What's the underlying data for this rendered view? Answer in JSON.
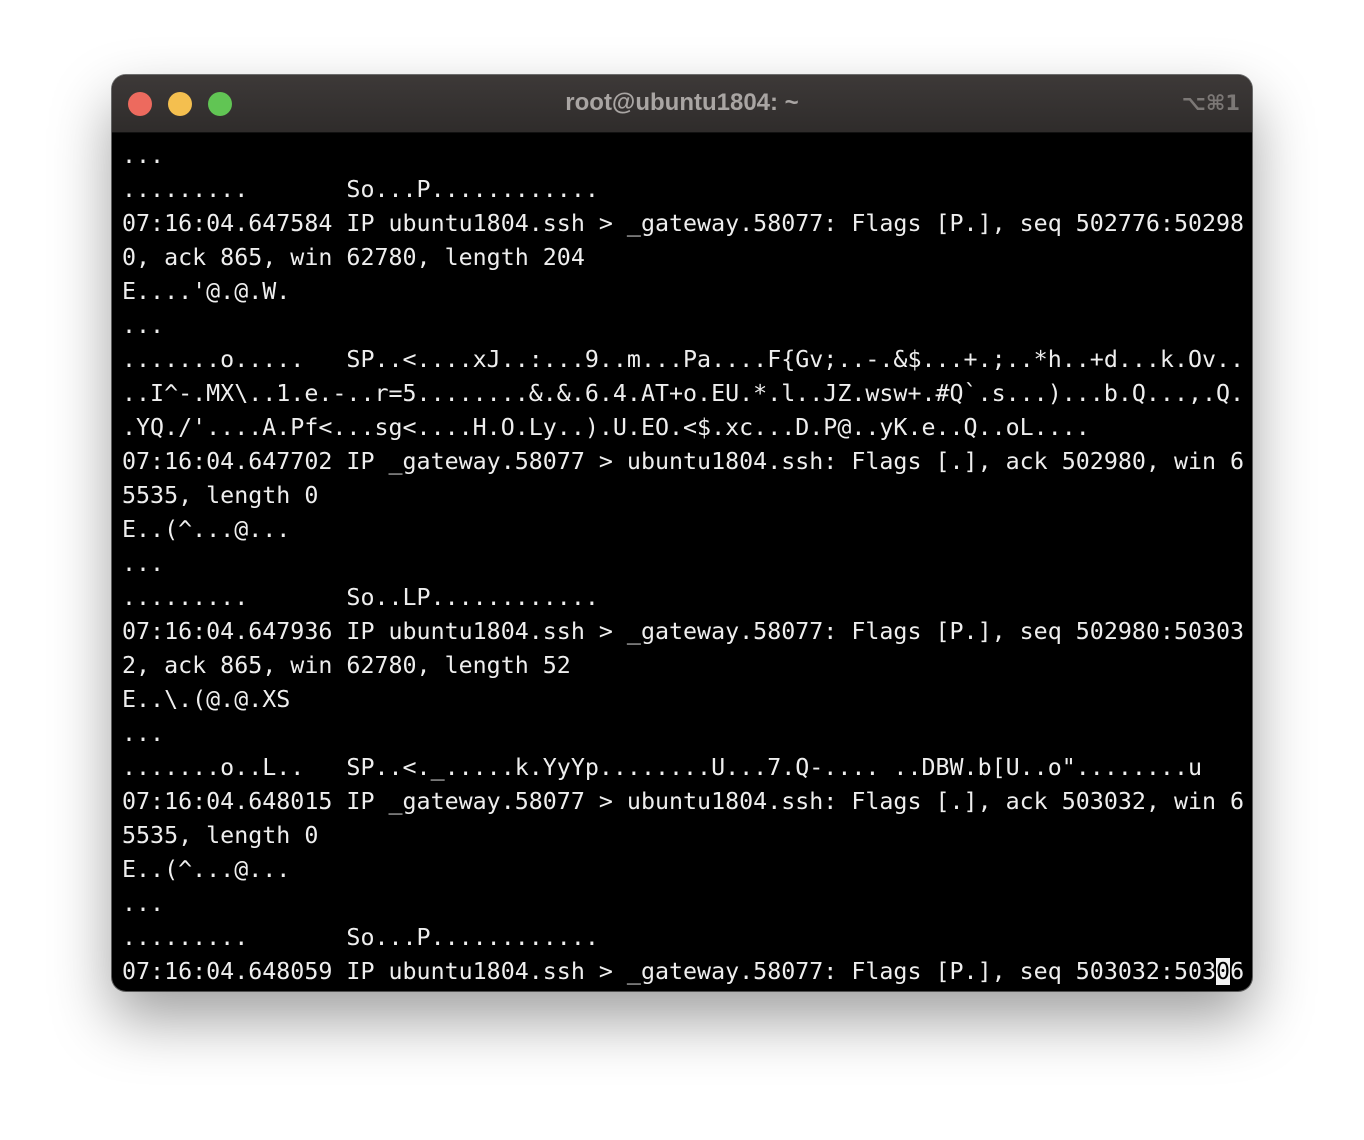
{
  "window": {
    "title": "root@ubuntu1804: ~",
    "shortcut": "⌥⌘1"
  },
  "terminal": {
    "lines": [
      "...",
      ".........       So...P............",
      "07:16:04.647584 IP ubuntu1804.ssh > _gateway.58077: Flags [P.], seq 502776:50298",
      "0, ack 865, win 62780, length 204",
      "E....'@.@.W.",
      "...",
      ".......o.....   SP..<....xJ..:...9..m...Pa....F{Gv;..-.&$...+.;..*h..+d...k.Ov..",
      "..I^-.MX\\..1.e.-..r=5........&.&.6.4.AT+o.EU.*.l..JZ.wsw+.#Q`.s...)...b.Q...,.Q.",
      ".YQ./'....A.Pf<...sg<....H.O.Ly..).U.EO.<$.xc...D.P@..yK.e..Q..oL....",
      "07:16:04.647702 IP _gateway.58077 > ubuntu1804.ssh: Flags [.], ack 502980, win 6",
      "5535, length 0",
      "E..(^...@...",
      "...",
      ".........       So..LP............",
      "07:16:04.647936 IP ubuntu1804.ssh > _gateway.58077: Flags [P.], seq 502980:50303",
      "2, ack 865, win 62780, length 52",
      "E..\\.(@.@.XS",
      "...",
      ".......o..L..   SP..<._.....k.YyYp........U...7.Q-.... ..DBW.b[U..o\"........u",
      "07:16:04.648015 IP _gateway.58077 > ubuntu1804.ssh: Flags [.], ack 503032, win 6",
      "5535, length 0",
      "E..(^...@...",
      "...",
      ".........       So...P............"
    ],
    "last_line_before_cursor": "07:16:04.648059 IP ubuntu1804.ssh > _gateway.58077: Flags [P.], seq 503032:503",
    "cursor_char": "0",
    "last_line_after_cursor": "6"
  }
}
